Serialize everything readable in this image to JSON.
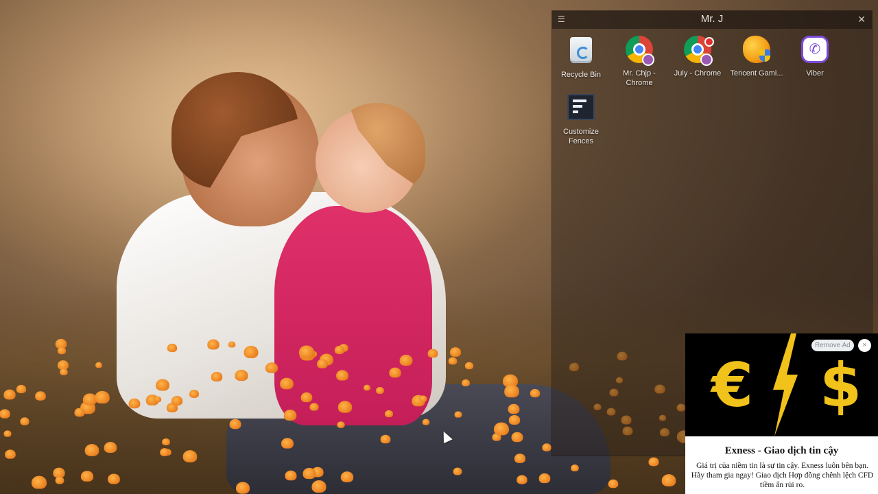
{
  "fence": {
    "title": "Mr. J",
    "menu_icon": "hamburger-icon",
    "close_icon": "close-icon",
    "icons": [
      {
        "label": "Recycle Bin",
        "icon": "recycle-bin-icon"
      },
      {
        "label": "Mr. Chjp - Chrome",
        "icon": "chrome-icon"
      },
      {
        "label": "July - Chrome",
        "icon": "chrome-icon"
      },
      {
        "label": "Tencent Gami...",
        "icon": "tencent-gaming-icon"
      },
      {
        "label": "Viber",
        "icon": "viber-icon"
      },
      {
        "label": "Customize Fences",
        "icon": "fences-icon"
      }
    ]
  },
  "ad": {
    "remove_label": "Remove Ad",
    "close_glyph": "×",
    "banner_symbols": [
      "€",
      "$"
    ],
    "title": "Exness - Giao dịch tin cậy",
    "body": "Giá trị của niềm tin là sự tin cậy. Exness luôn bên bạn. Hãy tham gia ngay! Giao dịch Hợp đồng chênh lệch CFD tiềm ẩn rủi ro.",
    "accent_color": "#f0c21a"
  },
  "colors": {
    "fence_bg": "rgba(40,30,24,0.45)",
    "flower": "#f08a1c",
    "dress": "#d42a62"
  }
}
